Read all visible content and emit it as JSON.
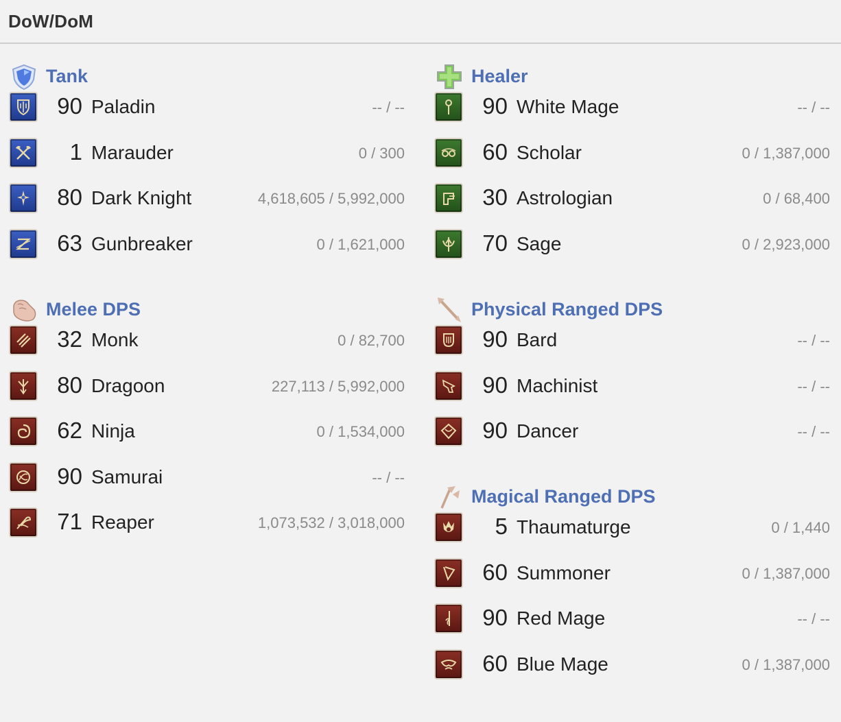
{
  "page": {
    "title": "DoW/DoM"
  },
  "categories": {
    "tank": {
      "label": "Tank",
      "icon": "shield-icon",
      "jobs": [
        {
          "level": "90",
          "name": "Paladin",
          "exp": "-- / --",
          "icon": "paladin-icon"
        },
        {
          "level": "1",
          "name": "Marauder",
          "exp": "0 / 300",
          "icon": "marauder-icon"
        },
        {
          "level": "80",
          "name": "Dark Knight",
          "exp": "4,618,605 / 5,992,000",
          "icon": "dark-knight-icon"
        },
        {
          "level": "63",
          "name": "Gunbreaker",
          "exp": "0 / 1,621,000",
          "icon": "gunbreaker-icon"
        }
      ]
    },
    "healer": {
      "label": "Healer",
      "icon": "green-cross-icon",
      "jobs": [
        {
          "level": "90",
          "name": "White Mage",
          "exp": "-- / --",
          "icon": "white-mage-icon"
        },
        {
          "level": "60",
          "name": "Scholar",
          "exp": "0 / 1,387,000",
          "icon": "scholar-icon"
        },
        {
          "level": "30",
          "name": "Astrologian",
          "exp": "0 / 68,400",
          "icon": "astrologian-icon"
        },
        {
          "level": "70",
          "name": "Sage",
          "exp": "0 / 2,923,000",
          "icon": "sage-icon"
        }
      ]
    },
    "melee": {
      "label": "Melee DPS",
      "icon": "fist-icon",
      "jobs": [
        {
          "level": "32",
          "name": "Monk",
          "exp": "0 / 82,700",
          "icon": "monk-icon"
        },
        {
          "level": "80",
          "name": "Dragoon",
          "exp": "227,113 / 5,992,000",
          "icon": "dragoon-icon"
        },
        {
          "level": "62",
          "name": "Ninja",
          "exp": "0 / 1,534,000",
          "icon": "ninja-icon"
        },
        {
          "level": "90",
          "name": "Samurai",
          "exp": "-- / --",
          "icon": "samurai-icon"
        },
        {
          "level": "71",
          "name": "Reaper",
          "exp": "1,073,532 / 3,018,000",
          "icon": "reaper-icon"
        }
      ]
    },
    "physical": {
      "label": "Physical Ranged DPS",
      "icon": "arrow-icon",
      "jobs": [
        {
          "level": "90",
          "name": "Bard",
          "exp": "-- / --",
          "icon": "bard-icon"
        },
        {
          "level": "90",
          "name": "Machinist",
          "exp": "-- / --",
          "icon": "machinist-icon"
        },
        {
          "level": "90",
          "name": "Dancer",
          "exp": "-- / --",
          "icon": "dancer-icon"
        }
      ]
    },
    "magical": {
      "label": "Magical Ranged DPS",
      "icon": "magic-staff-icon",
      "jobs": [
        {
          "level": "5",
          "name": "Thaumaturge",
          "exp": "0 / 1,440",
          "icon": "thaumaturge-icon"
        },
        {
          "level": "60",
          "name": "Summoner",
          "exp": "0 / 1,387,000",
          "icon": "summoner-icon"
        },
        {
          "level": "90",
          "name": "Red Mage",
          "exp": "-- / --",
          "icon": "red-mage-icon"
        },
        {
          "level": "60",
          "name": "Blue Mage",
          "exp": "0 / 1,387,000",
          "icon": "blue-mage-icon"
        }
      ]
    }
  },
  "colors": {
    "category_label": "#4e6fb3",
    "tank_icon": "#2a4aa8",
    "healer_icon": "#2f6224",
    "dps_icon": "#71221b",
    "exp_text": "#8a8a8a"
  }
}
